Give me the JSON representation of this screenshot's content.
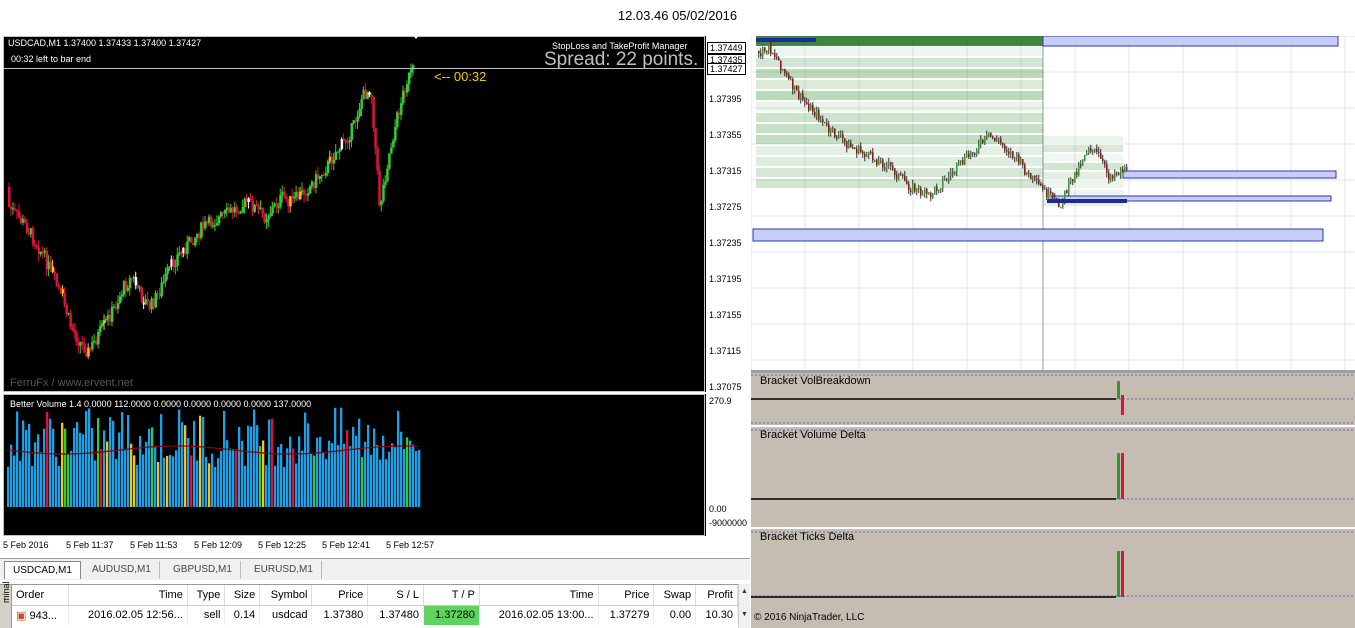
{
  "clock": "12.03.46 05/02/2016",
  "mt4": {
    "symbol_line": "USDCAD,M1  1.37400 1.37433 1.37400 1.37427",
    "bar_end": "00:32 left to bar end",
    "sl_tp_title": "StopLoss and TakeProfit Manager",
    "spread": "Spread: 22 points.",
    "timer": "<-- 00:32",
    "watermark": "FerruFx / www.ervent.net",
    "price_ticks": [
      "1.37395",
      "1.37355",
      "1.37315",
      "1.37275",
      "1.37235",
      "1.37195",
      "1.37155",
      "1.37115",
      "1.37075"
    ],
    "price_boxes": [
      "1.37449",
      "1.37435",
      "1.37427"
    ],
    "vol_title": "Better Volume 1.4 0.0000 112.0000 0.0000 0.0000 0.0000 0.0000 137.0000",
    "vol_ticks": [
      "270.9",
      "0.00",
      "-9000000"
    ],
    "time_ticks": [
      "5 Feb 2016",
      "5 Feb 11:37",
      "5 Feb 11:53",
      "5 Feb 12:09",
      "5 Feb 12:25",
      "5 Feb 12:41",
      "5 Feb 12:57"
    ],
    "tabs": [
      "USDCAD,M1",
      "AUDUSD,M1",
      "GBPUSD,M1",
      "EURUSD,M1"
    ],
    "terminal_label": "minal",
    "orders_headers": [
      "Order",
      "Time",
      "Type",
      "Size",
      "Symbol",
      "Price",
      "S / L",
      "T / P",
      "Time",
      "Price",
      "Swap",
      "Profit"
    ],
    "orders_rows": [
      [
        "943...",
        "2016.02.05 12:56...",
        "sell",
        "0.14",
        "usdcad",
        "1.37380",
        "1.37480",
        "1.37280",
        "2016.02.05 13:00...",
        "1.37279",
        "0.00",
        "10.30"
      ]
    ],
    "colors": {
      "bull": "#32cd32",
      "bear": "#dc143c",
      "wick": "#f5c518",
      "vol_blue": "#1ea0e6",
      "tp_green": "#5fd35f"
    }
  },
  "ninja": {
    "panels": [
      "Bracket VolBreakdown",
      "Bracket Volume Delta",
      "Bracket Ticks Delta"
    ],
    "copyright": "© 2016 NinjaTrader, LLC"
  },
  "icons": [
    "dropdown-arrow-icon",
    "scroll-up-icon",
    "scroll-down-icon",
    "order-icon"
  ]
}
